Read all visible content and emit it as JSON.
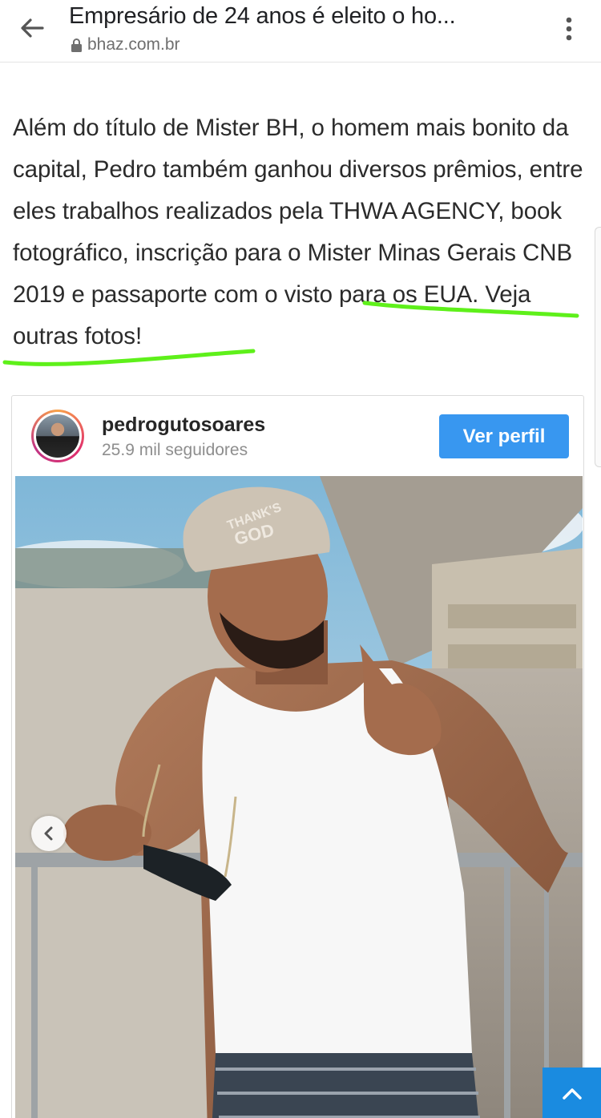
{
  "header": {
    "title": "Empresário de 24 anos é eleito o ho...",
    "url": "bhaz.com.br"
  },
  "article": {
    "paragraph_start": "Além do título de Mister BH, o homem mais bonito da capital, Pedro também ganhou diversos prêmios, entre eles trabalhos realizados pela THWA AGENCY, book fotográfico, inscrição para o Mister Minas Gerais CNB 2019 ",
    "paragraph_highlighted": "e passaporte com o visto para os EUA",
    "paragraph_end": ". Veja outras fotos!",
    "highlight_color": "#5ef01a"
  },
  "embed": {
    "username": "pedrogutosoares",
    "followers": "25.9 mil seguidores",
    "profile_button": "Ver perfil",
    "cap_text_line1": "THANK'S",
    "cap_text_line2": "GOD",
    "accent_color": "#3897f0"
  },
  "icons": {
    "back": "arrow-left-icon",
    "lock": "lock-icon",
    "menu": "more-vertical-icon",
    "prev": "chevron-left-icon",
    "scroll_top": "chevron-up-icon"
  }
}
